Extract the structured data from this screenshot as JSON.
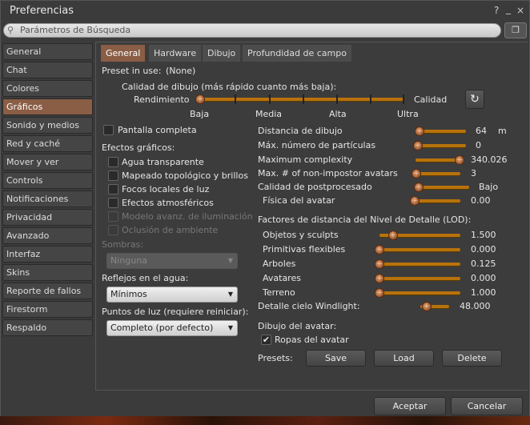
{
  "window": {
    "title": "Preferencias",
    "help": "?",
    "minimize": "_",
    "close": "×"
  },
  "search": {
    "placeholder": "Parámetros de Búsqueda"
  },
  "sidebar": {
    "items": [
      {
        "label": "General"
      },
      {
        "label": "Chat"
      },
      {
        "label": "Colores"
      },
      {
        "label": "Gráficos",
        "selected": true
      },
      {
        "label": "Sonido y medios"
      },
      {
        "label": "Red y caché"
      },
      {
        "label": "Mover y ver"
      },
      {
        "label": "Controls"
      },
      {
        "label": "Notificaciones"
      },
      {
        "label": "Privacidad"
      },
      {
        "label": "Avanzado"
      },
      {
        "label": "Interfaz"
      },
      {
        "label": "Skins"
      },
      {
        "label": "Reporte de fallos"
      },
      {
        "label": "Firestorm"
      },
      {
        "label": "Respaldo"
      }
    ]
  },
  "tabs": [
    {
      "label": "General"
    },
    {
      "label": "Hardware"
    },
    {
      "label": "Dibujo"
    },
    {
      "label": "Profundidad de campo"
    }
  ],
  "preset": {
    "label": "Preset in use:",
    "value": "(None)"
  },
  "quality": {
    "label": "Calidad de dibujo (más rápido cuanto más baja):",
    "left": "Rendimiento",
    "right": "Calidad",
    "level": 0,
    "ticks": [
      "Baja",
      "Media",
      "Alta",
      "Ultra"
    ]
  },
  "left": {
    "fullscreen": "Pantalla completa",
    "effects_label": "Efectos gráficos:",
    "effects": [
      {
        "label": "Agua transparente",
        "checked": false,
        "enabled": true
      },
      {
        "label": "Mapeado topológico y brillos",
        "checked": false,
        "enabled": true
      },
      {
        "label": "Focos locales de luz",
        "checked": false,
        "enabled": true
      },
      {
        "label": "Efectos atmosféricos",
        "checked": false,
        "enabled": true
      },
      {
        "label": "Modelo avanz. de iluminación",
        "checked": false,
        "enabled": false
      },
      {
        "label": "Oclusión de ambiente",
        "checked": false,
        "enabled": false
      }
    ],
    "shadows_label": "Sombras:",
    "shadows_value": "Ninguna",
    "water_label": "Reflejos en el agua:",
    "water_value": "Mínimos",
    "lights_label": "Puntos de luz (requiere reiniciar):",
    "lights_value": "Completo (por defecto)"
  },
  "right": {
    "sliders": [
      {
        "label": "Distancia de dibujo",
        "value": "64",
        "unit": "m",
        "level": 0
      },
      {
        "label": "Máx. número de partículas",
        "value": "0",
        "level": 0
      },
      {
        "label": "Maximum complexity",
        "value": "340.026",
        "level": 1
      },
      {
        "label": "Max. # of non-impostor avatars",
        "value": "3",
        "level": 0
      },
      {
        "label": "Calidad de postprocesado",
        "value": "Bajo",
        "level": 0
      },
      {
        "label": "Física del avatar",
        "value": "0.00",
        "level": 0
      }
    ],
    "lod_label": "Factores de distancia del Nivel de Detalle (LOD):",
    "lod": [
      {
        "label": "Objetos y sculpts",
        "value": "1.500",
        "level": 0.16
      },
      {
        "label": "Primitivas flexibles",
        "value": "0.000",
        "level": 0
      },
      {
        "label": "Arboles",
        "value": "0.125",
        "level": 0
      },
      {
        "label": "Avatares",
        "value": "0.000",
        "level": 0
      },
      {
        "label": "Terreno",
        "value": "1.000",
        "level": 0
      }
    ],
    "windlight": {
      "label": "Detalle cielo Windlight:",
      "value": "48.000",
      "level": 0.2
    },
    "avatar_label": "Dibujo del avatar:",
    "clothes": {
      "label": "Ropas del avatar",
      "checked": true
    },
    "presets_label": "Presets:",
    "save": "Save",
    "load": "Load",
    "delete": "Delete"
  },
  "footer": {
    "ok": "Aceptar",
    "cancel": "Cancelar"
  }
}
